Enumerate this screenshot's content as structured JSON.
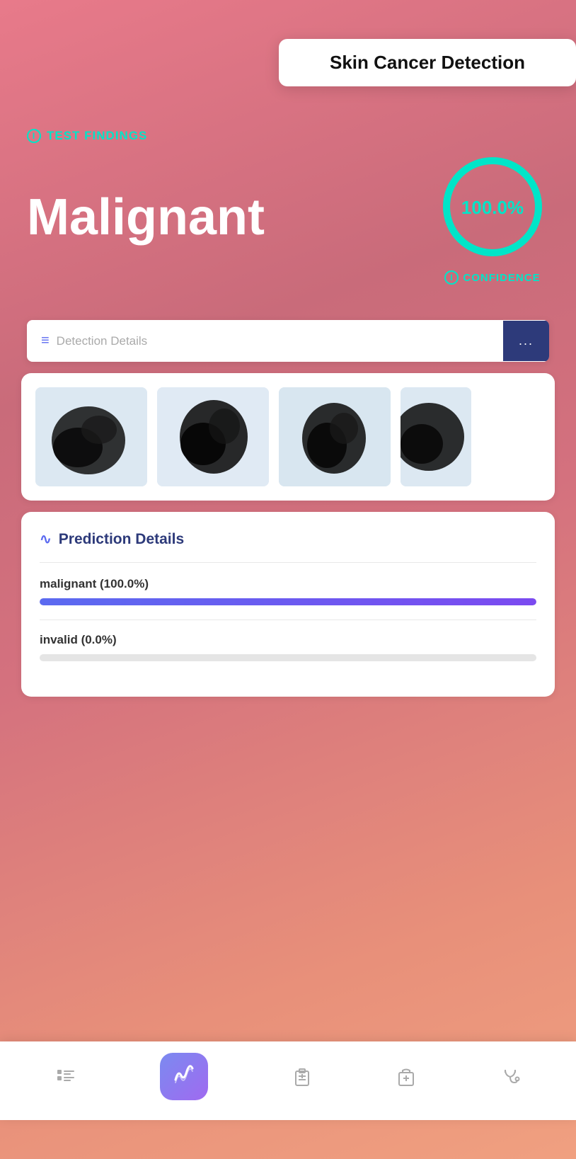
{
  "header": {
    "title": "Skin Cancer Detection"
  },
  "findings": {
    "section_label": "TEST FINDINGS",
    "result": "Malignant",
    "confidence_percent": "100.0%",
    "confidence_label": "CONFIDENCE"
  },
  "detection_bar": {
    "label": "Detection Details",
    "button_label": "..."
  },
  "prediction": {
    "title": "Prediction Details",
    "items": [
      {
        "label": "malignant (100.0%)",
        "fill_percent": 100
      },
      {
        "label": "invalid (0.0%)",
        "fill_percent": 0
      }
    ]
  },
  "bottom_nav": {
    "items": [
      {
        "name": "list-icon",
        "symbol": "⊞",
        "active": false
      },
      {
        "name": "chart-icon",
        "symbol": "≋",
        "active": true
      },
      {
        "name": "clipboard-icon",
        "symbol": "📋",
        "active": false
      },
      {
        "name": "hospital-icon",
        "symbol": "⊕",
        "active": false
      },
      {
        "name": "stethoscope-icon",
        "symbol": "⚕",
        "active": false
      }
    ]
  },
  "colors": {
    "accent": "#00e5c8",
    "dark_blue": "#2d3a7a",
    "purple": "#5b6af0",
    "progress": "#6b5af0"
  }
}
